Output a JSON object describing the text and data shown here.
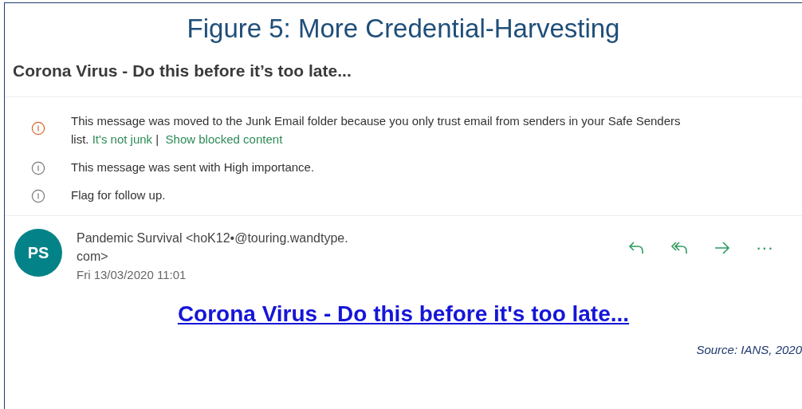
{
  "figure_title": "Figure 5: More Credential-Harvesting",
  "subject": "Corona Virus - Do this before it’s too late...",
  "notices": [
    {
      "kind": "warning",
      "text": "This message was moved to the Junk Email folder because you only trust email from senders in your Safe Senders list.",
      "links": [
        "It's not junk",
        "Show blocked content"
      ],
      "separator": "|"
    },
    {
      "kind": "info",
      "text": "This message was sent with High importance."
    },
    {
      "kind": "info",
      "text": "Flag for follow up."
    }
  ],
  "sender": {
    "initials": "PS",
    "name_line_1": "Pandemic Survival <hoK12•@touring.wandtype.",
    "name_line_2": "com>",
    "date": "Fri 13/03/2020 11:01"
  },
  "actions": [
    {
      "kind": "reply"
    },
    {
      "kind": "reply_all"
    },
    {
      "kind": "forward"
    },
    {
      "kind": "more",
      "label": "···"
    }
  ],
  "body_link": "Corona Virus - Do this before it's too late...",
  "source": "Source: IANS, 2020"
}
